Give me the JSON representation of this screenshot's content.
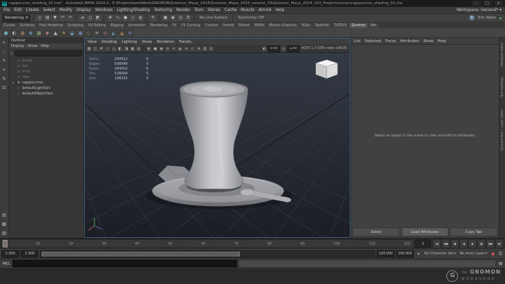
{
  "colors": {
    "accent": "#5285a6",
    "viewport_bg": "#262a32",
    "maya_teal": "#0e9598"
  },
  "titlebar": {
    "app_icon_letter": "M",
    "title": "cappuccino_shading_01.ma* - Autodesk MAYA 2024.2 - E:\\Projects\\kentWork\\GNOMON\\Gnomon_Maya_2024\\Gnomon_Maya_2024_volume_03\\Gnomon_Maya_2024_v03_Project\\scenes\\cappuccino_shading_01.ma",
    "minimize_glyph": "–",
    "maximize_glyph": "□",
    "close_glyph": "×"
  },
  "menubar": {
    "items": [
      "File",
      "Edit",
      "Create",
      "Select",
      "Modify",
      "Display",
      "Windows",
      "Lighting/Shading",
      "Texturing",
      "Render",
      "Toon",
      "Stereo",
      "Cache",
      "Muscle",
      "Arnold",
      "Help"
    ],
    "workspace_label": "Workspace:",
    "workspace_value": "General*",
    "arrow": "▾"
  },
  "statusline": {
    "menuset": "Rendering",
    "arrow": "▾",
    "icons": [
      "▯",
      "▤",
      "▼",
      "↶",
      "↷",
      "≡",
      "◻",
      "◩",
      "#",
      "∿",
      "●",
      "◇",
      "◍",
      "✎",
      "▣",
      "◉",
      "◎",
      "☰"
    ],
    "no_live_surface": "No Live Surface",
    "symmetry": "Symmetry: Off",
    "user_name": "Eric Keller",
    "user_initial": "E"
  },
  "shelf": {
    "tabs": [
      "Curves",
      "Surfaces",
      "Poly Modeling",
      "Sculpting",
      "UV Editing",
      "Rigging",
      "Animation",
      "Rendering",
      "FX",
      "FX Caching",
      "Custom",
      "Arnold",
      "Bifrost",
      "MASH",
      "Motion Graphics",
      "XGen",
      "Redshift",
      "TURTLE",
      "Gnomon",
      "Net"
    ],
    "active_tab": "Gnomon",
    "icons": [
      "●",
      "◐",
      "◍",
      "◉",
      "▦",
      "◆",
      "▲",
      "☀",
      "◒",
      "▣",
      "◇",
      "≋",
      "◎",
      "◭",
      "◮",
      "⊕"
    ]
  },
  "toolbox": {
    "tools": [
      "↖",
      "◌",
      "✎",
      "+",
      "↻",
      "⊡"
    ],
    "layouts": [
      "▤",
      "▦",
      "▧"
    ]
  },
  "outliner": {
    "title": "Outliner",
    "menus": [
      "Display",
      "Show",
      "Help"
    ],
    "search_value": "",
    "items": [
      {
        "arrow": "",
        "icon": "▱",
        "label": "persp"
      },
      {
        "arrow": "",
        "icon": "▱",
        "label": "top"
      },
      {
        "arrow": "",
        "icon": "▱",
        "label": "front"
      },
      {
        "arrow": "",
        "icon": "▱",
        "label": "side"
      },
      {
        "arrow": "▸",
        "icon": "⊕",
        "label": "cappuccino"
      },
      {
        "arrow": "",
        "icon": "◌",
        "label": "defaultLightSet"
      },
      {
        "arrow": "",
        "icon": "◌",
        "label": "defaultObjectSet"
      }
    ]
  },
  "viewport": {
    "menus": [
      "View",
      "Shading",
      "Lighting",
      "Show",
      "Renderer",
      "Panels"
    ],
    "icons": [
      "▦",
      "◫",
      "#",
      "▭",
      "◻",
      "◧",
      "◨",
      "▣",
      "◍",
      "◐",
      "●",
      "◉",
      "◎",
      "☀",
      "◒",
      "≋",
      "◇",
      "⊕",
      "▤",
      "☰"
    ],
    "exposure_icon": "◐",
    "exposure": "0.00",
    "gamma_icon": "γ",
    "gamma": "1.00",
    "colorspace": "ACES 1.0 SDR-video (sRGB)",
    "hud": [
      {
        "label": "Verts:",
        "value": "194912",
        "selected": "0"
      },
      {
        "label": "Edges:",
        "value": "508048",
        "selected": "0"
      },
      {
        "label": "Faces:",
        "value": "264002",
        "selected": "0"
      },
      {
        "label": "Tris:",
        "value": "528004",
        "selected": "0"
      },
      {
        "label": "UVs:",
        "value": "198242",
        "selected": "0"
      }
    ]
  },
  "attribute_editor": {
    "menus": [
      "List",
      "Selected",
      "Focus",
      "Attributes",
      "Show",
      "Help"
    ],
    "message": "Select an object in the scene to view and edit its attributes.",
    "buttons": [
      "Select",
      "Load Attributes",
      "Copy Tab"
    ]
  },
  "right_strip": {
    "tabs": [
      "Attribute Editor",
      "Tool Settings",
      "Channel Box / Layer Editor"
    ]
  },
  "timeline": {
    "ticks": [
      "1",
      "10",
      "20",
      "30",
      "40",
      "50",
      "60",
      "70",
      "80",
      "90",
      "100",
      "110",
      "120"
    ],
    "current_frame": "1",
    "transport": [
      "|◀",
      "◀◀",
      "◀|",
      "◀",
      "▶",
      "|▶",
      "▶▶",
      "▶|"
    ]
  },
  "range": {
    "anim_start": "1.000",
    "playback_start": "1.000",
    "playback_end": "120.000",
    "anim_end": "200.000",
    "bookmark_glyph": "▾",
    "character_set": "No Character Set",
    "anim_layer": "No Anim Layer",
    "arrow": "▾",
    "autokey_glyph": "●",
    "prefs_glyph": "☰"
  },
  "command_line": {
    "label": "MEL",
    "input_value": "",
    "script_editor_glyph": "▤"
  },
  "watermark": {
    "prefix": "THE",
    "name": "GNOMON",
    "suffix": "WORKSHOP",
    "logo_letter": "G"
  }
}
